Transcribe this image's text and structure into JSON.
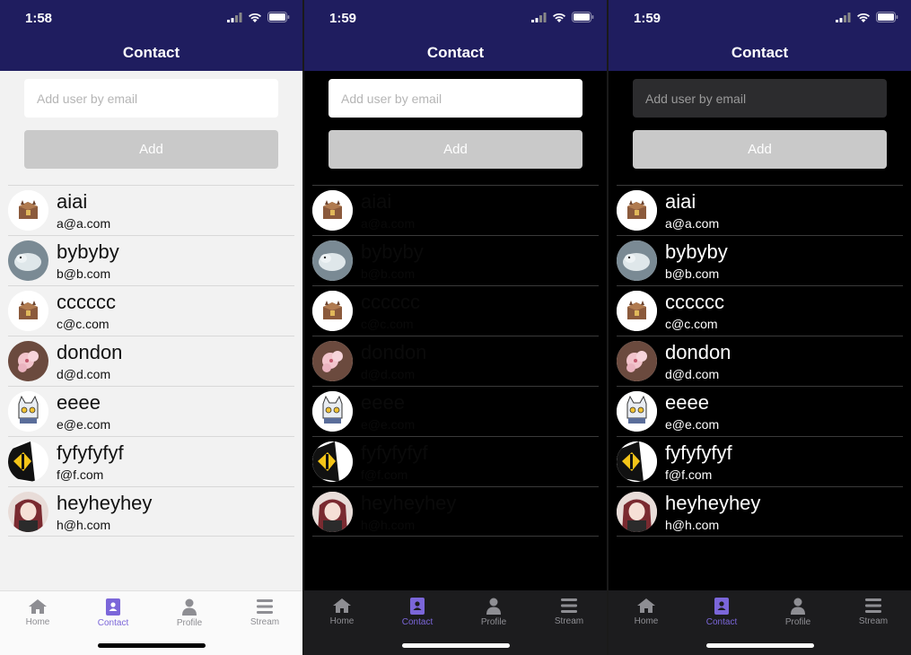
{
  "screens": [
    {
      "time": "1:58",
      "title": "Contact",
      "placeholder": "Add user by email",
      "add_label": "Add"
    },
    {
      "time": "1:59",
      "title": "Contact",
      "placeholder": "Add user by email",
      "add_label": "Add"
    },
    {
      "time": "1:59",
      "title": "Contact",
      "placeholder": "Add user by email",
      "add_label": "Add"
    }
  ],
  "contacts": [
    {
      "name": "aiai",
      "email": "a@a.com",
      "avatar": "treasure-chest"
    },
    {
      "name": "bybyby",
      "email": "b@b.com",
      "avatar": "white-bird"
    },
    {
      "name": "cccccc",
      "email": "c@c.com",
      "avatar": "treasure-chest"
    },
    {
      "name": "dondon",
      "email": "d@d.com",
      "avatar": "cherry-blossom"
    },
    {
      "name": "eeee",
      "email": "e@e.com",
      "avatar": "cat-robot"
    },
    {
      "name": "fyfyfyfyf",
      "email": "f@f.com",
      "avatar": "yellow-eye"
    },
    {
      "name": "heyheyhey",
      "email": "h@h.com",
      "avatar": "anime-girl"
    }
  ],
  "tabs": [
    {
      "label": "Home",
      "icon": "home-icon"
    },
    {
      "label": "Contact",
      "icon": "contact-book-icon"
    },
    {
      "label": "Profile",
      "icon": "person-icon"
    },
    {
      "label": "Stream",
      "icon": "stream-list-icon"
    }
  ],
  "colors": {
    "header": "#1f1d5f",
    "active_tab": "#7b66d9",
    "add_button": "#c9c9c9"
  }
}
